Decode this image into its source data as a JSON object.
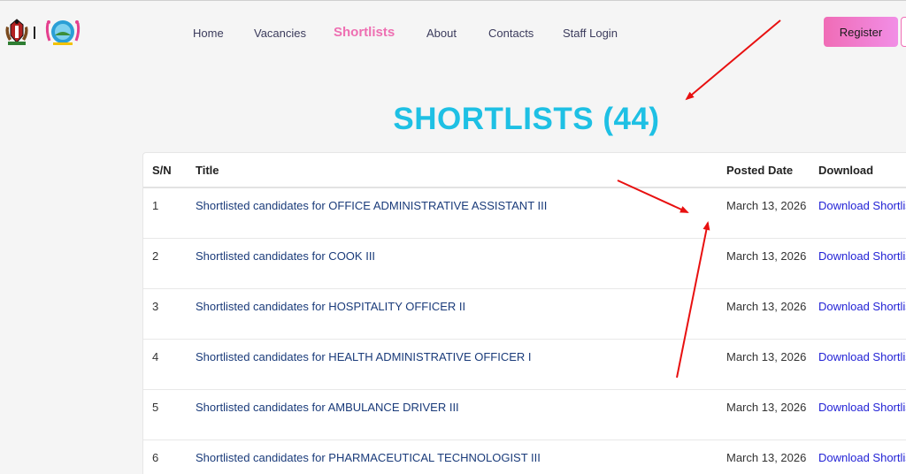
{
  "nav": {
    "items": [
      {
        "label": "Home"
      },
      {
        "label": "Vacancies"
      },
      {
        "label": "Shortlists"
      },
      {
        "label": "About"
      },
      {
        "label": "Contacts"
      },
      {
        "label": "Staff Login"
      }
    ],
    "active": "Shortlists",
    "register_label": "Register"
  },
  "main": {
    "heading": "SHORTLISTS (44)",
    "table": {
      "headers": [
        "S/N",
        "Title",
        "Posted Date",
        "Download"
      ],
      "rows": [
        {
          "sn": "1",
          "title": "Shortlisted candidates for OFFICE ADMINISTRATIVE ASSISTANT III",
          "date": "March 13, 2026",
          "download": "Download Shortlist"
        },
        {
          "sn": "2",
          "title": "Shortlisted candidates for COOK III",
          "date": "March 13, 2026",
          "download": "Download Shortlist"
        },
        {
          "sn": "3",
          "title": "Shortlisted candidates for HOSPITALITY OFFICER II",
          "date": "March 13, 2026",
          "download": "Download Shortlist"
        },
        {
          "sn": "4",
          "title": "Shortlisted candidates for HEALTH ADMINISTRATIVE OFFICER I",
          "date": "March 13, 2026",
          "download": "Download Shortlist"
        },
        {
          "sn": "5",
          "title": "Shortlisted candidates for AMBULANCE DRIVER III",
          "date": "March 13, 2026",
          "download": "Download Shortlist"
        },
        {
          "sn": "6",
          "title": "Shortlisted candidates for PHARMACEUTICAL TECHNOLOGIST III",
          "date": "March 13, 2026",
          "download": "Download Shortlist"
        }
      ]
    }
  },
  "colors": {
    "accent_pink": "#ee6fb2",
    "heading_cyan": "#1ec0e4",
    "link_blue": "#2323d6",
    "title_navy": "#1a3b7a",
    "annotation_red": "#e81010"
  },
  "icons": [
    "kenya-coat-of-arms-logo",
    "county-logo"
  ]
}
